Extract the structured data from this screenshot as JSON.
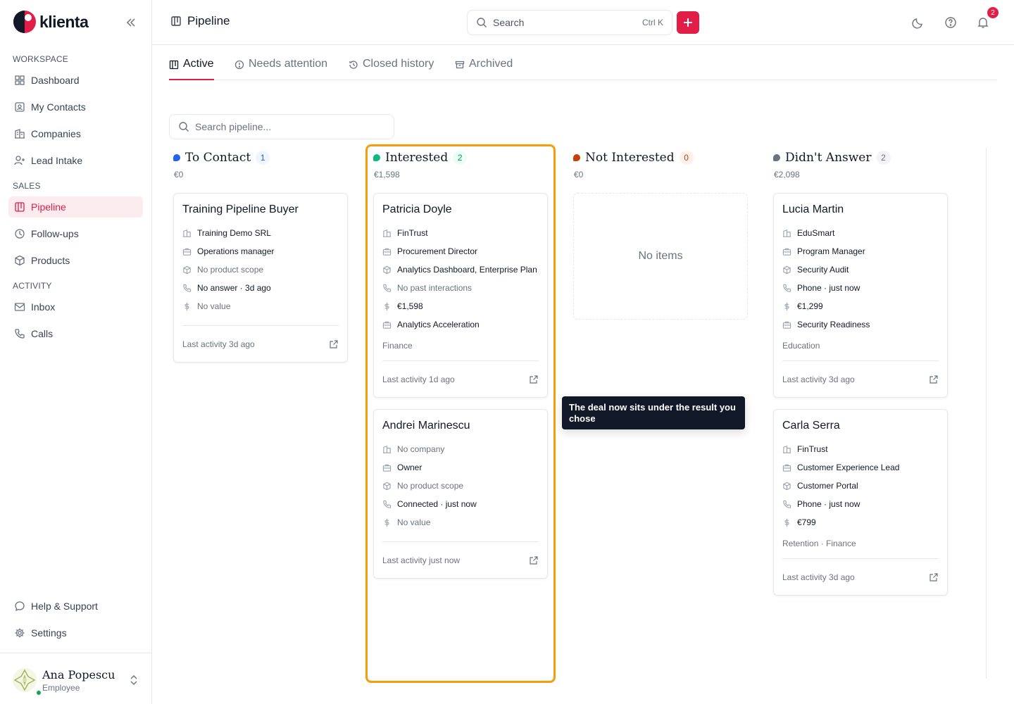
{
  "app": {
    "name": "klienta"
  },
  "sidebar": {
    "sections": [
      "WORKSPACE",
      "SALES",
      "ACTIVITY"
    ],
    "items": [
      {
        "label": "Dashboard",
        "icon": "dashboard-icon"
      },
      {
        "label": "My Contacts",
        "icon": "contacts-icon"
      },
      {
        "label": "Companies",
        "icon": "building-icon"
      },
      {
        "label": "Lead Intake",
        "icon": "user-plus-icon"
      },
      {
        "label": "Pipeline",
        "icon": "pipeline-icon",
        "active": true
      },
      {
        "label": "Follow-ups",
        "icon": "clock-icon"
      },
      {
        "label": "Products",
        "icon": "package-icon"
      },
      {
        "label": "Inbox",
        "icon": "mail-icon"
      },
      {
        "label": "Calls",
        "icon": "phone-icon"
      }
    ],
    "bottom": [
      {
        "label": "Help & Support",
        "icon": "chat-icon"
      },
      {
        "label": "Settings",
        "icon": "gear-icon"
      }
    ],
    "user": {
      "name": "Ana Popescu",
      "role": "Employee"
    }
  },
  "header": {
    "title": "Pipeline",
    "search_placeholder": "Search",
    "shortcut": "Ctrl K",
    "notifications_count": "2"
  },
  "tabs": [
    {
      "label": "Active",
      "active": true
    },
    {
      "label": "Needs attention"
    },
    {
      "label": "Closed history"
    },
    {
      "label": "Archived"
    }
  ],
  "pipeline_search_placeholder": "Search pipeline...",
  "columns": [
    {
      "title": "To Contact",
      "count": "1",
      "total": "€0",
      "color": "#2563eb",
      "cards": [
        {
          "name": "Training Pipeline Buyer",
          "company": "Training Demo SRL",
          "role": "Operations manager",
          "product": "No product scope",
          "interaction": "No answer · 3d ago",
          "value": "No value",
          "last_activity": "Last activity 3d ago"
        }
      ]
    },
    {
      "title": "Interested",
      "count": "2",
      "total": "€1,598",
      "color": "#10b981",
      "cards": [
        {
          "name": "Patricia Doyle",
          "company": "FinTrust",
          "role": "Procurement Director",
          "product": "Analytics Dashboard, Enterprise Plan",
          "interaction": "No past interactions",
          "value": "€1,598",
          "deal": "Analytics Acceleration",
          "tags": "Finance",
          "last_activity": "Last activity 1d ago"
        },
        {
          "name": "Andrei Marinescu",
          "company": "No company",
          "role": "Owner",
          "product": "No product scope",
          "interaction": "Connected · just now",
          "value": "No value",
          "last_activity": "Last activity just now"
        }
      ]
    },
    {
      "title": "Not Interested",
      "count": "0",
      "total": "€0",
      "color": "#c2410c",
      "empty_text": "No items"
    },
    {
      "title": "Didn't Answer",
      "count": "2",
      "total": "€2,098",
      "color": "#6b7280",
      "cards": [
        {
          "name": "Lucia Martin",
          "company": "EduSmart",
          "role": "Program Manager",
          "product": "Security Audit",
          "interaction": "Phone · just now",
          "value": "€1,299",
          "deal": "Security Readiness",
          "tags": "Education",
          "last_activity": "Last activity 3d ago"
        },
        {
          "name": "Carla Serra",
          "company": "FinTrust",
          "role": "Customer Experience Lead",
          "product": "Customer Portal",
          "interaction": "Phone · just now",
          "value": "€799",
          "tags": "Retention · Finance",
          "last_activity": "Last activity 3d ago"
        }
      ]
    }
  ],
  "tooltip": "The deal now sits under the result you chose",
  "colors": {
    "accent": "#e11d48",
    "highlight": "#f59e0b"
  }
}
